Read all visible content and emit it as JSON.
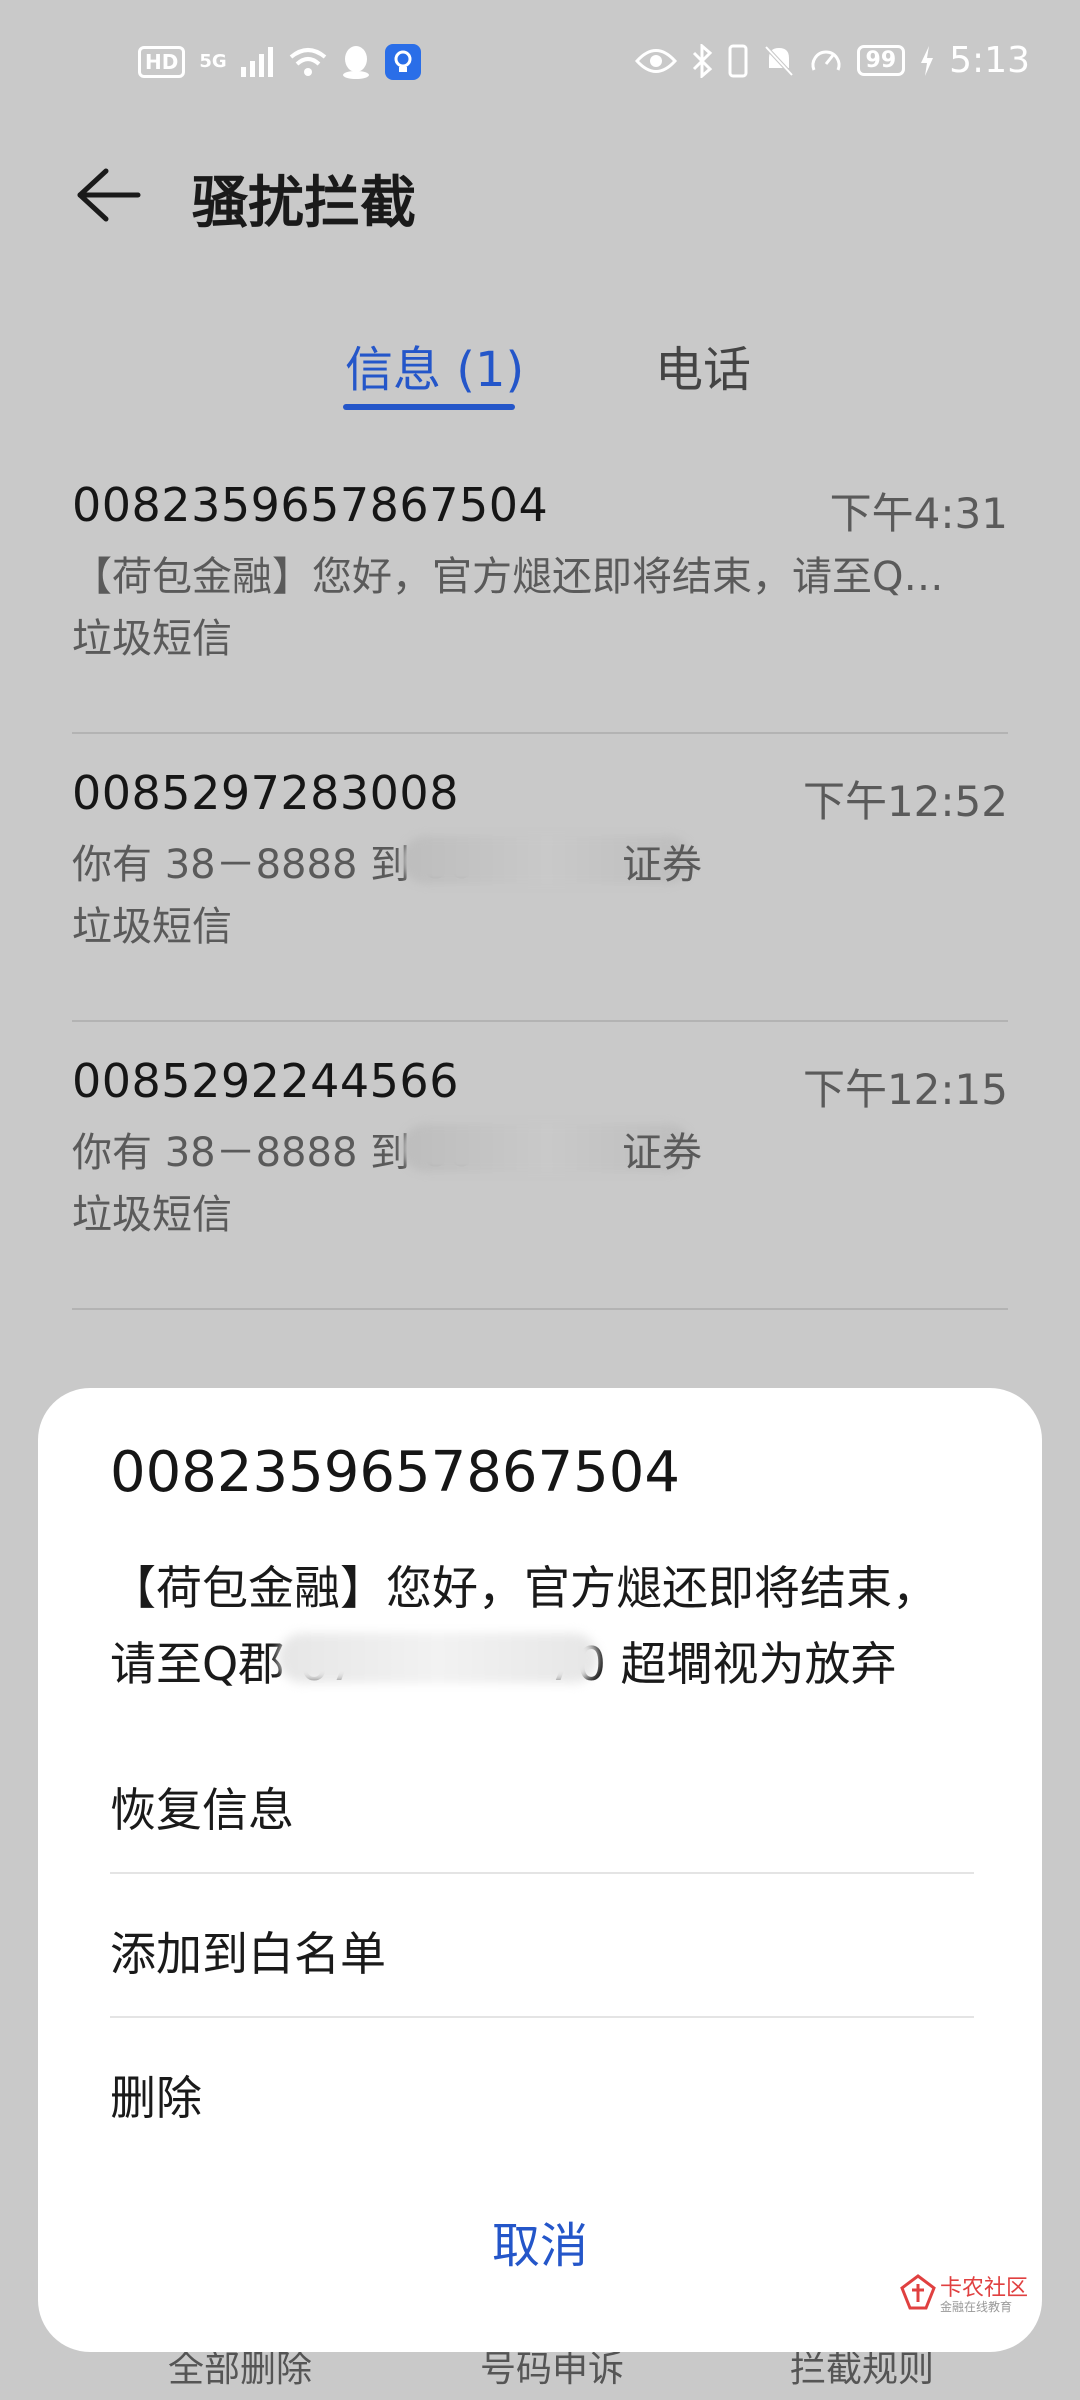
{
  "status_bar": {
    "hd": "HD",
    "network": "5G",
    "battery": "99",
    "time": "5:13"
  },
  "header": {
    "title": "骚扰拦截"
  },
  "tabs": [
    {
      "label": "信息 (1)",
      "active": true
    },
    {
      "label": "电话",
      "active": false
    }
  ],
  "messages": [
    {
      "sender": "0082359657867504",
      "time": "下午4:31",
      "preview": "【荷包金融】您好，官方煺还即将结束，请至Q…",
      "label": "垃圾短信"
    },
    {
      "sender": "0085297283008",
      "time": "下午12:52",
      "preview": "你有 38－8888 到 86",
      "preview_tail": "证券",
      "label": "垃圾短信"
    },
    {
      "sender": "0085292244566",
      "time": "下午12:15",
      "preview": "你有 38－8888 到 86",
      "preview_tail": "证券",
      "label": "垃圾短信"
    }
  ],
  "bottom_toolbar": [
    "全部删除",
    "号码申诉",
    "拦截规则"
  ],
  "sheet": {
    "title": "0082359657867504",
    "body_line1": "【荷包金融】您好，官方煺还即将结束，",
    "body_line2_start": "请至Q郡 67",
    "body_line2_end": "70 超墹视为放弃",
    "actions": [
      "恢复信息",
      "添加到白名单",
      "删除"
    ],
    "cancel": "取消"
  },
  "watermark": {
    "text": "卡农社区",
    "sub": "金融在线教育"
  },
  "colors": {
    "accent": "#2456c9",
    "scrim_background": "#c9c9c9",
    "sheet_background": "#ffffff"
  }
}
